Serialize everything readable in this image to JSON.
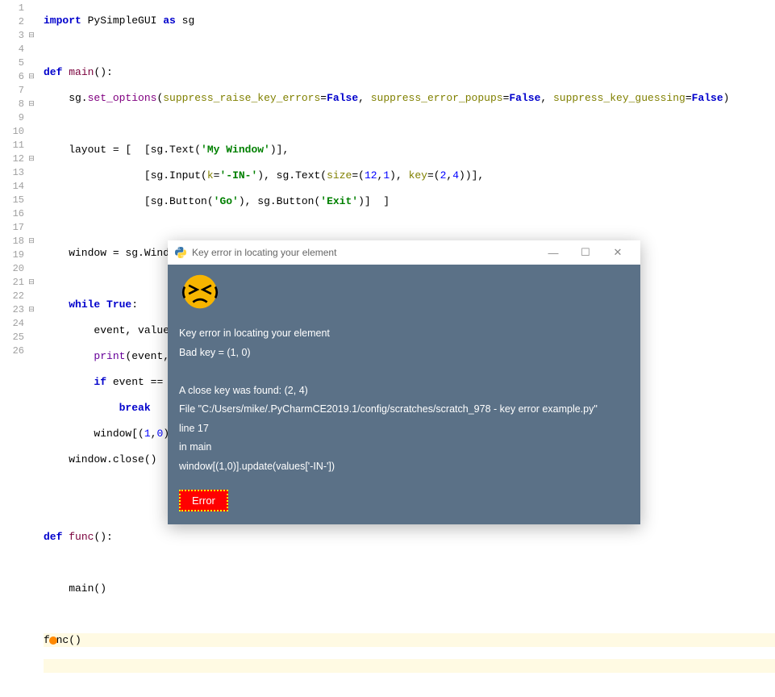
{
  "code": {
    "l1": "import PySimpleGUI as sg",
    "l3": "def main():",
    "l4": "    sg.set_options(suppress_raise_key_errors=False, suppress_error_popups=False, suppress_key_guessing=False)",
    "l6": "    layout = [  [sg.Text('My Window')],",
    "l7": "                [sg.Input(k='-IN-'), sg.Text(size=(12,1), key=(2,4))],",
    "l8": "                [sg.Button('Go'), sg.Button('Exit')]  ]",
    "l10": "    window = sg.Window('Window Title', layout, finalize=True)",
    "l12": "    while True:             # Event Loop",
    "l13": "        event, values = window.read()",
    "l14": "        print(event, values)",
    "l15": "        if event == sg.WIN_CLOSED or event == 'Exit':",
    "l16": "            break",
    "l17": "        window[(1,0)].update(values['-IN-'])",
    "l18": "    window.close()",
    "l21": "def func():",
    "l23": "    main()",
    "l25": "func()"
  },
  "dialog": {
    "title": "Key error in locating your element",
    "line1": "Key error in locating your element",
    "line2": "Bad key = (1, 0)",
    "line3": "A close key was found: (2, 4)",
    "line4": "  File \"C:/Users/mike/.PyCharmCE2019.1/config/scratches/scratch_978 - key error example.py\"",
    "line5": "line 17",
    "line6": "in main",
    "line7": "    window[(1,0)].update(values['-IN-'])",
    "button": "Error"
  },
  "lineNumbers": [
    "1",
    "2",
    "3",
    "4",
    "5",
    "6",
    "7",
    "8",
    "9",
    "10",
    "11",
    "12",
    "13",
    "14",
    "15",
    "16",
    "17",
    "18",
    "19",
    "20",
    "21",
    "22",
    "23",
    "24",
    "25",
    "26"
  ]
}
